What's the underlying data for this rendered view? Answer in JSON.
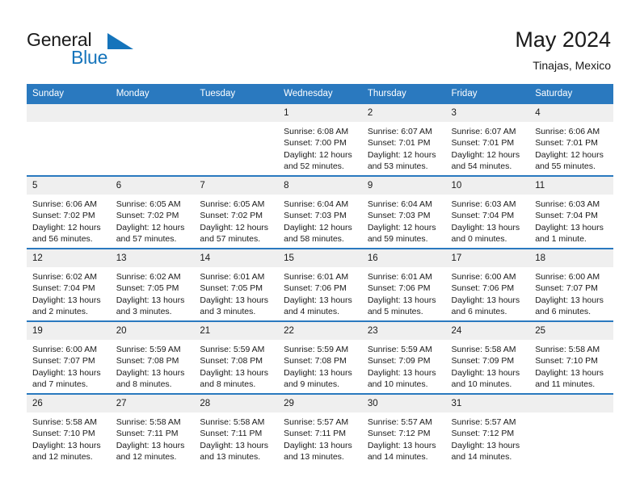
{
  "brand": {
    "line1": "General",
    "line2": "Blue",
    "logo_icon": "blue-triangle-logo",
    "colors": {
      "blue": "#1574bb",
      "dark": "#1a1a1a"
    }
  },
  "header": {
    "title": "May 2024",
    "subtitle": "Tinajas, Mexico"
  },
  "theme": {
    "header_blue": "#2a79bf",
    "daynum_band": "#efefef",
    "text": "#1a1a1a"
  },
  "calendar": {
    "weekday_headers": [
      "Sunday",
      "Monday",
      "Tuesday",
      "Wednesday",
      "Thursday",
      "Friday",
      "Saturday"
    ],
    "weeks": [
      [
        {
          "day": "",
          "empty": true,
          "sunrise": "",
          "sunset": "",
          "daylight1": "",
          "daylight2": ""
        },
        {
          "day": "",
          "empty": true,
          "sunrise": "",
          "sunset": "",
          "daylight1": "",
          "daylight2": ""
        },
        {
          "day": "",
          "empty": true,
          "sunrise": "",
          "sunset": "",
          "daylight1": "",
          "daylight2": ""
        },
        {
          "day": "1",
          "sunrise": "Sunrise: 6:08 AM",
          "sunset": "Sunset: 7:00 PM",
          "daylight1": "Daylight: 12 hours",
          "daylight2": "and 52 minutes."
        },
        {
          "day": "2",
          "sunrise": "Sunrise: 6:07 AM",
          "sunset": "Sunset: 7:01 PM",
          "daylight1": "Daylight: 12 hours",
          "daylight2": "and 53 minutes."
        },
        {
          "day": "3",
          "sunrise": "Sunrise: 6:07 AM",
          "sunset": "Sunset: 7:01 PM",
          "daylight1": "Daylight: 12 hours",
          "daylight2": "and 54 minutes."
        },
        {
          "day": "4",
          "sunrise": "Sunrise: 6:06 AM",
          "sunset": "Sunset: 7:01 PM",
          "daylight1": "Daylight: 12 hours",
          "daylight2": "and 55 minutes."
        }
      ],
      [
        {
          "day": "5",
          "sunrise": "Sunrise: 6:06 AM",
          "sunset": "Sunset: 7:02 PM",
          "daylight1": "Daylight: 12 hours",
          "daylight2": "and 56 minutes."
        },
        {
          "day": "6",
          "sunrise": "Sunrise: 6:05 AM",
          "sunset": "Sunset: 7:02 PM",
          "daylight1": "Daylight: 12 hours",
          "daylight2": "and 57 minutes."
        },
        {
          "day": "7",
          "sunrise": "Sunrise: 6:05 AM",
          "sunset": "Sunset: 7:02 PM",
          "daylight1": "Daylight: 12 hours",
          "daylight2": "and 57 minutes."
        },
        {
          "day": "8",
          "sunrise": "Sunrise: 6:04 AM",
          "sunset": "Sunset: 7:03 PM",
          "daylight1": "Daylight: 12 hours",
          "daylight2": "and 58 minutes."
        },
        {
          "day": "9",
          "sunrise": "Sunrise: 6:04 AM",
          "sunset": "Sunset: 7:03 PM",
          "daylight1": "Daylight: 12 hours",
          "daylight2": "and 59 minutes."
        },
        {
          "day": "10",
          "sunrise": "Sunrise: 6:03 AM",
          "sunset": "Sunset: 7:04 PM",
          "daylight1": "Daylight: 13 hours",
          "daylight2": "and 0 minutes."
        },
        {
          "day": "11",
          "sunrise": "Sunrise: 6:03 AM",
          "sunset": "Sunset: 7:04 PM",
          "daylight1": "Daylight: 13 hours",
          "daylight2": "and 1 minute."
        }
      ],
      [
        {
          "day": "12",
          "sunrise": "Sunrise: 6:02 AM",
          "sunset": "Sunset: 7:04 PM",
          "daylight1": "Daylight: 13 hours",
          "daylight2": "and 2 minutes."
        },
        {
          "day": "13",
          "sunrise": "Sunrise: 6:02 AM",
          "sunset": "Sunset: 7:05 PM",
          "daylight1": "Daylight: 13 hours",
          "daylight2": "and 3 minutes."
        },
        {
          "day": "14",
          "sunrise": "Sunrise: 6:01 AM",
          "sunset": "Sunset: 7:05 PM",
          "daylight1": "Daylight: 13 hours",
          "daylight2": "and 3 minutes."
        },
        {
          "day": "15",
          "sunrise": "Sunrise: 6:01 AM",
          "sunset": "Sunset: 7:06 PM",
          "daylight1": "Daylight: 13 hours",
          "daylight2": "and 4 minutes."
        },
        {
          "day": "16",
          "sunrise": "Sunrise: 6:01 AM",
          "sunset": "Sunset: 7:06 PM",
          "daylight1": "Daylight: 13 hours",
          "daylight2": "and 5 minutes."
        },
        {
          "day": "17",
          "sunrise": "Sunrise: 6:00 AM",
          "sunset": "Sunset: 7:06 PM",
          "daylight1": "Daylight: 13 hours",
          "daylight2": "and 6 minutes."
        },
        {
          "day": "18",
          "sunrise": "Sunrise: 6:00 AM",
          "sunset": "Sunset: 7:07 PM",
          "daylight1": "Daylight: 13 hours",
          "daylight2": "and 6 minutes."
        }
      ],
      [
        {
          "day": "19",
          "sunrise": "Sunrise: 6:00 AM",
          "sunset": "Sunset: 7:07 PM",
          "daylight1": "Daylight: 13 hours",
          "daylight2": "and 7 minutes."
        },
        {
          "day": "20",
          "sunrise": "Sunrise: 5:59 AM",
          "sunset": "Sunset: 7:08 PM",
          "daylight1": "Daylight: 13 hours",
          "daylight2": "and 8 minutes."
        },
        {
          "day": "21",
          "sunrise": "Sunrise: 5:59 AM",
          "sunset": "Sunset: 7:08 PM",
          "daylight1": "Daylight: 13 hours",
          "daylight2": "and 8 minutes."
        },
        {
          "day": "22",
          "sunrise": "Sunrise: 5:59 AM",
          "sunset": "Sunset: 7:08 PM",
          "daylight1": "Daylight: 13 hours",
          "daylight2": "and 9 minutes."
        },
        {
          "day": "23",
          "sunrise": "Sunrise: 5:59 AM",
          "sunset": "Sunset: 7:09 PM",
          "daylight1": "Daylight: 13 hours",
          "daylight2": "and 10 minutes."
        },
        {
          "day": "24",
          "sunrise": "Sunrise: 5:58 AM",
          "sunset": "Sunset: 7:09 PM",
          "daylight1": "Daylight: 13 hours",
          "daylight2": "and 10 minutes."
        },
        {
          "day": "25",
          "sunrise": "Sunrise: 5:58 AM",
          "sunset": "Sunset: 7:10 PM",
          "daylight1": "Daylight: 13 hours",
          "daylight2": "and 11 minutes."
        }
      ],
      [
        {
          "day": "26",
          "sunrise": "Sunrise: 5:58 AM",
          "sunset": "Sunset: 7:10 PM",
          "daylight1": "Daylight: 13 hours",
          "daylight2": "and 12 minutes."
        },
        {
          "day": "27",
          "sunrise": "Sunrise: 5:58 AM",
          "sunset": "Sunset: 7:11 PM",
          "daylight1": "Daylight: 13 hours",
          "daylight2": "and 12 minutes."
        },
        {
          "day": "28",
          "sunrise": "Sunrise: 5:58 AM",
          "sunset": "Sunset: 7:11 PM",
          "daylight1": "Daylight: 13 hours",
          "daylight2": "and 13 minutes."
        },
        {
          "day": "29",
          "sunrise": "Sunrise: 5:57 AM",
          "sunset": "Sunset: 7:11 PM",
          "daylight1": "Daylight: 13 hours",
          "daylight2": "and 13 minutes."
        },
        {
          "day": "30",
          "sunrise": "Sunrise: 5:57 AM",
          "sunset": "Sunset: 7:12 PM",
          "daylight1": "Daylight: 13 hours",
          "daylight2": "and 14 minutes."
        },
        {
          "day": "31",
          "sunrise": "Sunrise: 5:57 AM",
          "sunset": "Sunset: 7:12 PM",
          "daylight1": "Daylight: 13 hours",
          "daylight2": "and 14 minutes."
        },
        {
          "day": "",
          "empty": true,
          "sunrise": "",
          "sunset": "",
          "daylight1": "",
          "daylight2": ""
        }
      ]
    ]
  }
}
